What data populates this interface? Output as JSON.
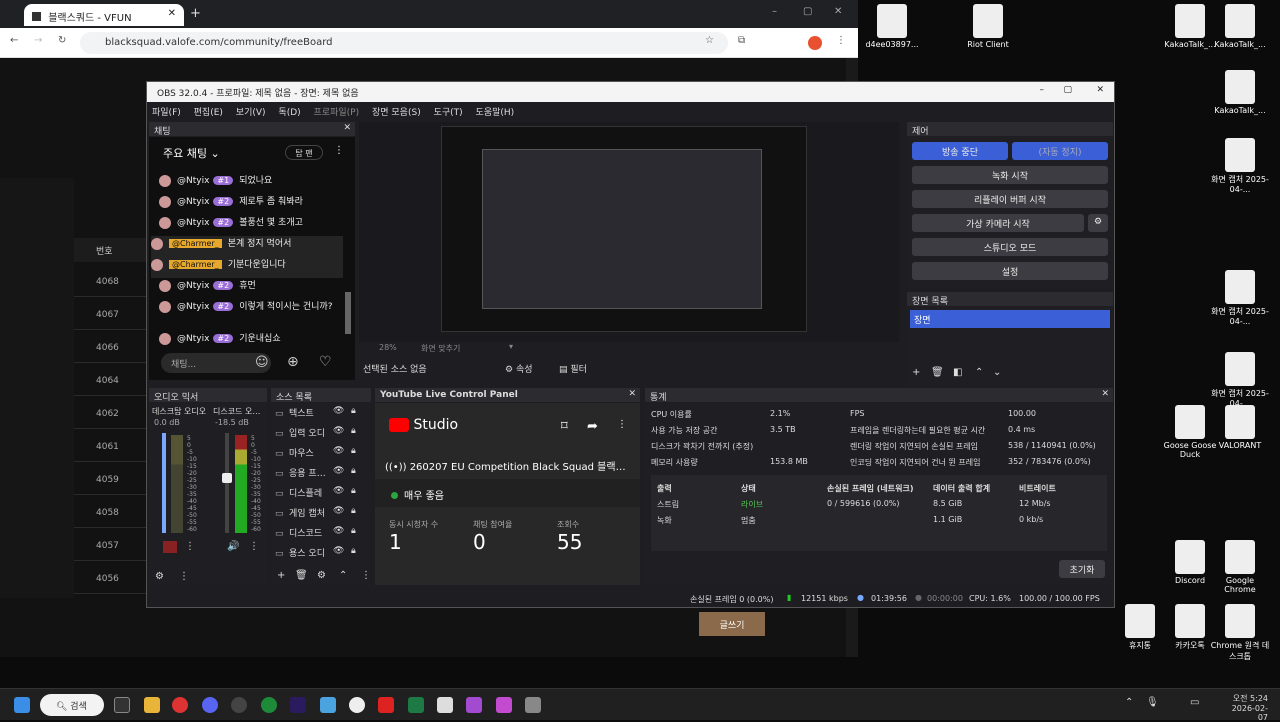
{
  "browser": {
    "tab_title": "블랙스쿼드 - VFUN",
    "url": "blacksquad.valofe.com/community/freeBoard",
    "board_header": "번호",
    "rows": [
      "4068",
      "4067",
      "4066",
      "4064",
      "4062",
      "4061",
      "4059",
      "4058",
      "4057",
      "4056"
    ],
    "write_button": "글쓰기"
  },
  "desktop": {
    "icons": [
      {
        "label": "d4ee03897...",
        "name": "file"
      },
      {
        "label": "Riot Client",
        "name": "riot"
      },
      {
        "label": "KakaoTalk_...",
        "name": "kakao1"
      },
      {
        "label": "KakaoTalk_...",
        "name": "kakao2"
      },
      {
        "label": "KakaoTalk_...",
        "name": "kakao3"
      },
      {
        "label": "화면 캡처 2025-04-...",
        "name": "cap1"
      },
      {
        "label": "화면 캡처 2025-04-...",
        "name": "cap2"
      },
      {
        "label": "화면 캡처 2025-04-...",
        "name": "cap3"
      },
      {
        "label": "Goose Goose Duck",
        "name": "goose"
      },
      {
        "label": "VALORANT",
        "name": "valorant"
      },
      {
        "label": "Discord",
        "name": "discord"
      },
      {
        "label": "Google Chrome",
        "name": "chrome"
      },
      {
        "label": "휴지통",
        "name": "trash"
      },
      {
        "label": "카카오톡",
        "name": "kakaotalk"
      },
      {
        "label": "Chrome 원격 데스크톱",
        "name": "remote"
      }
    ]
  },
  "obs": {
    "title": "OBS 32.0.4 - 프로파일: 제목 없음 - 장면: 제목 없음",
    "menu": [
      "파일(F)",
      "편집(E)",
      "보기(V)",
      "독(D)",
      "프로파일(P)",
      "장면 모음(S)",
      "도구(T)",
      "도움말(H)"
    ],
    "chat": {
      "dock_title": "채팅",
      "header": "주요 채팅",
      "top_fans": "탑 팬",
      "input_placeholder": "채팅...",
      "messages": [
        {
          "user": "@Ntyix",
          "badge": "#1",
          "text": "되었나요"
        },
        {
          "user": "@Ntyix",
          "badge": "#2",
          "text": "제로투 좀 춰봐라"
        },
        {
          "user": "@Ntyix",
          "badge": "#2",
          "text": "볼풍선 몇 초개고"
        },
        {
          "user": "@Charmer_",
          "badge": "",
          "text": "본계 정지 먹어서"
        },
        {
          "user": "@Charmer_",
          "badge": "",
          "text": "기분다운입니다"
        },
        {
          "user": "@Ntyix",
          "badge": "#2",
          "text": "휴먼"
        },
        {
          "user": "@Ntyix",
          "badge": "#2",
          "text": "이렇게 적이시는 건니까?"
        },
        {
          "user": "@Ntyix",
          "badge": "#2",
          "text": "기운내십쇼"
        }
      ]
    },
    "preview": {
      "zoom": "28%",
      "fit": "화면 맞추기",
      "no_source": "선택된 소스 없음",
      "properties": "속성",
      "filters": "필터"
    },
    "controls": {
      "dock_title": "제어",
      "stop_stream": "방송 중단",
      "auto_stop": "(자동 정지)",
      "start_record": "녹화 시작",
      "replay_buffer": "리플레이 버퍼 시작",
      "virtual_cam": "가상 카메라 시작",
      "studio_mode": "스튜디오 모드",
      "settings": "설정"
    },
    "scenes": {
      "dock_title": "장면 목록",
      "items": [
        "장면"
      ]
    },
    "audio": {
      "dock_title": "오디오 믹서",
      "channels": [
        {
          "name": "데스크탑 오디오",
          "db": "0.0 dB"
        },
        {
          "name": "디스코드 오디오",
          "db": "-18.5 dB"
        }
      ],
      "scale": [
        "5",
        "0",
        "-5",
        "-10",
        "-15",
        "-20",
        "-25",
        "-30",
        "-35",
        "-40",
        "-45",
        "-50",
        "-55",
        "-60"
      ]
    },
    "sources": {
      "dock_title": "소스 목록",
      "items": [
        "텍스트",
        "입력 오디",
        "마우스",
        "응용 프로그",
        "디스플레",
        "게임 캡처",
        "디스코드",
        "용스 오디"
      ]
    },
    "yt": {
      "dock_title": "YouTube Live Control Panel",
      "logo": "Studio",
      "stream_title": "260207 EU Competition Black Squad 블랙스...",
      "health": "매우 좋음",
      "stats": [
        {
          "label": "동시 시청자 수",
          "value": "1"
        },
        {
          "label": "채팅 참여율",
          "value": "0"
        },
        {
          "label": "조회수",
          "value": "55"
        }
      ]
    },
    "stats": {
      "dock_title": "통계",
      "left": [
        [
          "CPU 이용률",
          "2.1%"
        ],
        [
          "사용 가능 저장 공간",
          "3.5 TB"
        ],
        [
          "디스크가 꽉차기 전까지 (추정)",
          ""
        ],
        [
          "메모리 사용량",
          "153.8 MB"
        ]
      ],
      "right": [
        [
          "FPS",
          "100.00"
        ],
        [
          "프레임을 렌더링하는데 필요한 평균 시간",
          "0.4 ms"
        ],
        [
          "렌더링 작업이 지연되어 손실된 프레임",
          "538 / 1140941 (0.0%)"
        ],
        [
          "인코딩 작업이 지연되어 건너 뛴 프레임",
          "352 / 783476 (0.0%)"
        ]
      ],
      "table_headers": [
        "출력",
        "상태",
        "손실된 프레임 (네트워크)",
        "데이터 출력 합계",
        "비트레이트"
      ],
      "table_rows": [
        [
          "스트림",
          "라이브",
          "0 / 599616 (0.0%)",
          "8.5 GiB",
          "12 Mb/s"
        ],
        [
          "녹화",
          "멈춤",
          "",
          "1.1 GiB",
          "0 kb/s"
        ]
      ],
      "reset": "초기화"
    },
    "statusbar": {
      "dropped": "손실된 프레임 0 (0.0%)",
      "kbps": "12151 kbps",
      "stream_time": "01:39:56",
      "rec_time": "00:00:00",
      "cpu": "CPU: 1.6%",
      "fps": "100.00 / 100.00 FPS"
    }
  },
  "taskbar": {
    "search": "검색",
    "time": "오전 5:24",
    "date": "2026-02-07"
  }
}
